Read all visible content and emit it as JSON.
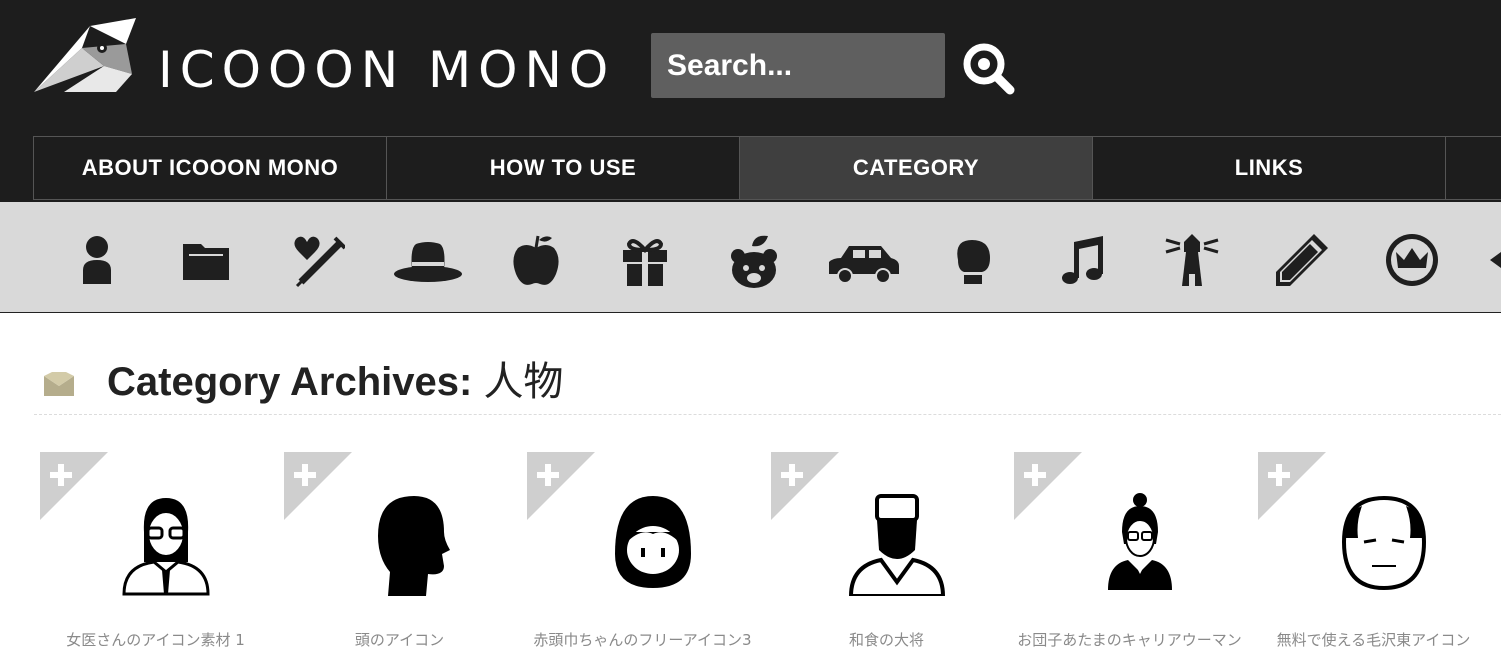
{
  "header": {
    "logo_text": "ICOOON MONO",
    "search": {
      "placeholder": "Search..."
    }
  },
  "nav": [
    {
      "label": "ABOUT ICOOON MONO"
    },
    {
      "label": "HOW TO USE"
    },
    {
      "label": "CATEGORY",
      "active": true
    },
    {
      "label": "LINKS"
    }
  ],
  "categories": [
    "person-icon",
    "folder-icon",
    "medical-icon",
    "hat-icon",
    "apple-icon",
    "gift-icon",
    "bear-icon",
    "car-icon",
    "boxing-glove-icon",
    "music-note-icon",
    "lighthouse-icon",
    "pencil-icon",
    "crown-icon"
  ],
  "page": {
    "title_prefix": "Category Archives: ",
    "title_category": "人物"
  },
  "icons": [
    {
      "label": "女医さんのアイコン素材 1",
      "icon": "female-doctor-icon"
    },
    {
      "label": "頭のアイコン",
      "icon": "head-icon"
    },
    {
      "label": "赤頭巾ちゃんのフリーアイコン3",
      "icon": "red-riding-hood-icon"
    },
    {
      "label": "和食の大将",
      "icon": "japanese-chef-icon"
    },
    {
      "label": "お団子あたまのキャリアウーマン",
      "icon": "career-woman-icon"
    },
    {
      "label": "無料で使える毛沢東アイコン",
      "icon": "old-man-icon"
    }
  ],
  "colors": {
    "header_bg": "#1d1d1d",
    "strip_bg": "#d9d9d9",
    "active_nav": "#3f3f3f",
    "label": "#8a8a8a"
  }
}
